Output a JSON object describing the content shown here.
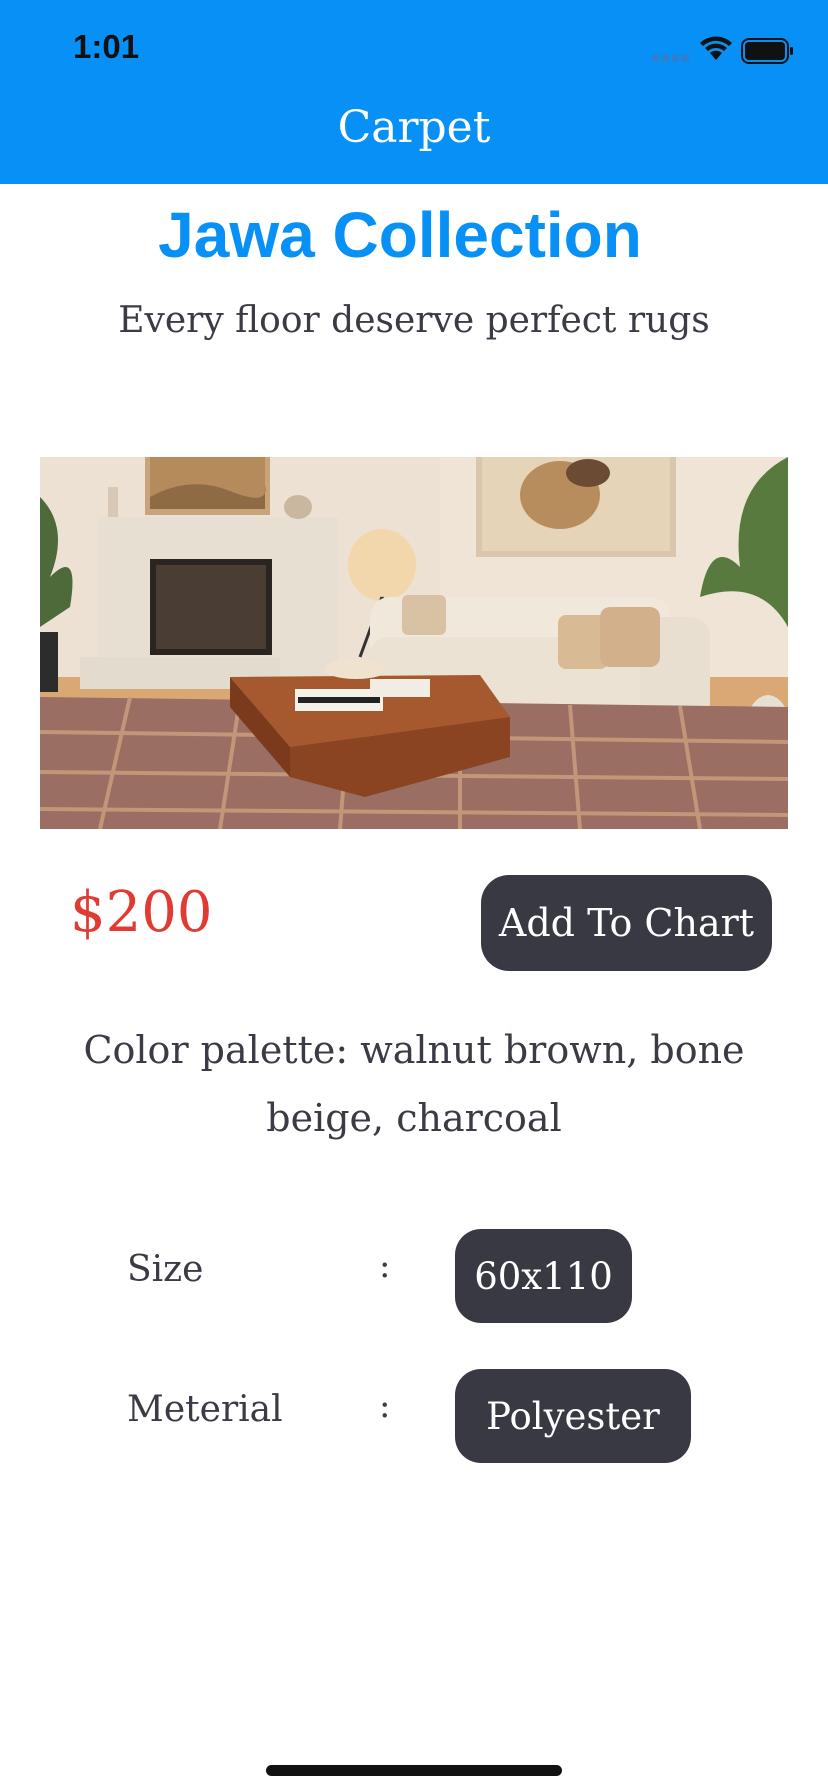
{
  "status_bar": {
    "time": "1:01"
  },
  "nav": {
    "title": "Carpet"
  },
  "product": {
    "collection": "Jawa Collection",
    "tagline": "Every floor deserve perfect rugs",
    "price": "$200",
    "add_button": "Add To Chart",
    "palette_line1": "Color palette: walnut brown, bone",
    "palette_line2": "beige, charcoal",
    "attributes": [
      {
        "label": "Size",
        "separator": ":",
        "value": "60x110"
      },
      {
        "label": "Meterial",
        "separator": ":",
        "value": "Polyester"
      }
    ]
  },
  "colors": {
    "primary": "#0790F5",
    "price": "#e03a32",
    "button": "#383943",
    "text": "#3a3b45"
  },
  "icons": [
    "signal-icon",
    "wifi-icon",
    "battery-icon"
  ]
}
